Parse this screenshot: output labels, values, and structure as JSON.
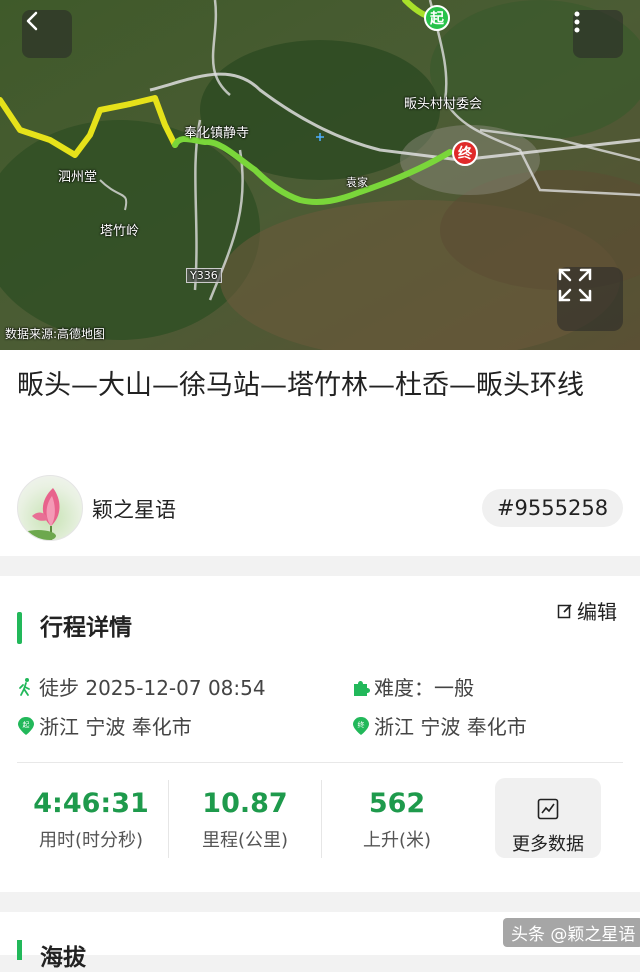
{
  "map": {
    "source_label": "数据来源:高德地图",
    "places": {
      "temple": "奉化镇静寺",
      "hall": "泗州堂",
      "peak": "塔竹岭",
      "village": "畈头村村委会",
      "hamlet": "袁家",
      "road": "Y336"
    },
    "start_marker": "起",
    "end_marker": "终",
    "icons": {
      "back": "back-arrow-icon",
      "more": "more-vertical-icon",
      "expand": "expand-icon"
    },
    "colors": {
      "route_start": "#e6e21a",
      "route_end": "#7ad63a",
      "end_marker": "#e02a2a",
      "start_marker": "#28c24b"
    }
  },
  "route": {
    "title": "畈头—大山—徐马站—塔竹林—杜岙—畈头环线",
    "author": "颖之星语",
    "id": "#9555258"
  },
  "details": {
    "section_title": "行程详情",
    "edit_label": "编辑",
    "activity": "徒步 2025-12-07 08:54",
    "difficulty": "难度：一般",
    "start_location": "浙江 宁波 奉化市",
    "end_location": "浙江 宁波 奉化市",
    "stats": [
      {
        "value": "4:46:31",
        "label": "用时(时分秒)"
      },
      {
        "value": "10.87",
        "label": "里程(公里)"
      },
      {
        "value": "562",
        "label": "上升(米)"
      }
    ],
    "more_data_label": "更多数据",
    "accent_color": "#1e9a4c"
  },
  "next_section": {
    "title": "海拔"
  },
  "watermark": "头条 @颖之星语"
}
